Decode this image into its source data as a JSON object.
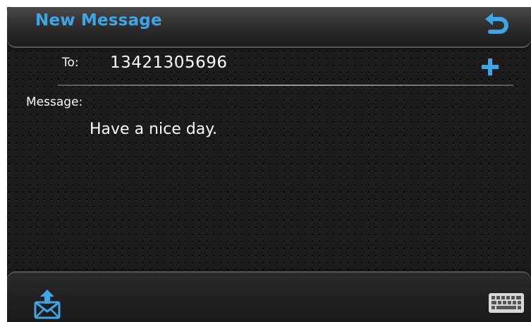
{
  "header": {
    "title": "New Message"
  },
  "recipient": {
    "label": "To:",
    "value": "13421305696"
  },
  "message": {
    "label": "Message:",
    "body": "Have a nice day."
  },
  "icons": {
    "back": "back-arrow-icon",
    "add": "plus-icon",
    "send": "send-envelope-icon",
    "keyboard": "keyboard-icon"
  },
  "colors": {
    "accent": "#3fa6e6",
    "background": "#1b1b1b",
    "text": "#ffffff"
  }
}
